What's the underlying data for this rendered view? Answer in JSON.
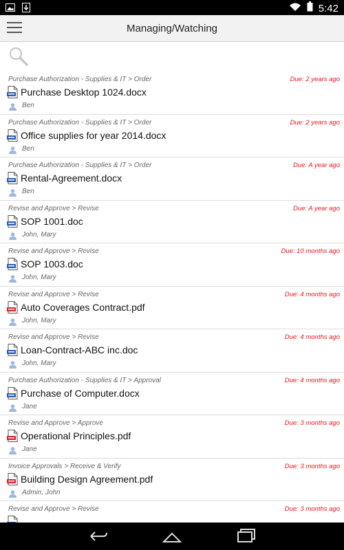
{
  "status_bar": {
    "time": "5:42",
    "icons": [
      "gallery-icon",
      "download-icon",
      "wifi-icon",
      "battery-icon"
    ]
  },
  "app_bar": {
    "title": "Managing/Watching",
    "menu_icon": "hamburger-menu-icon"
  },
  "search": {
    "icon": "search-icon"
  },
  "items": [
    {
      "path": "Purchase Authorization - Supplies & IT > Order",
      "name": "Purchase Desktop 1024.docx",
      "type": "doc",
      "people": "Ben",
      "due": "Due: 2 years ago"
    },
    {
      "path": "Purchase Authorization - Supplies & IT > Order",
      "name": "Office supplies for year 2014.docx",
      "type": "doc",
      "people": "Ben",
      "due": "Due: 2 years ago"
    },
    {
      "path": "Purchase Authorization - Supplies & IT > Order",
      "name": "Rental-Agreement.docx",
      "type": "doc",
      "people": "Ben",
      "due": "Due: A year ago"
    },
    {
      "path": "Revise and Approve > Revise",
      "name": "SOP 1001.doc",
      "type": "doc",
      "people": "John, Mary",
      "due": "Due: A year ago"
    },
    {
      "path": "Revise and Approve > Revise",
      "name": "SOP 1003.doc",
      "type": "doc",
      "people": "John, Mary",
      "due": "Due: 10 months ago"
    },
    {
      "path": "Revise and Approve > Revise",
      "name": "Auto Coverages Contract.pdf",
      "type": "pdf",
      "people": "John, Mary",
      "due": "Due: 4 months ago"
    },
    {
      "path": "Revise and Approve > Revise",
      "name": "Loan-Contract-ABC inc.doc",
      "type": "doc",
      "people": "John, Mary",
      "due": "Due: 4 months ago"
    },
    {
      "path": "Purchase Authorization - Supplies & IT > Approval",
      "name": "Purchase of Computer.docx",
      "type": "doc",
      "people": "Jane",
      "due": "Due: 4 months ago"
    },
    {
      "path": "Revise and Approve > Approve",
      "name": "Operational Principles.pdf",
      "type": "pdf",
      "people": "Jane",
      "due": "Due: 3 months ago"
    },
    {
      "path": "Invoice Approvals > Receive & Verify",
      "name": "Building Design Agreement.pdf",
      "type": "pdf",
      "people": "Admin, John",
      "due": "Due: 3 months ago"
    },
    {
      "path": "Revise and Approve > Revise",
      "name": "",
      "type": "doc",
      "people": "",
      "due": "Due: 3 months ago"
    }
  ],
  "colors": {
    "due_text": "#e8151b",
    "doc_icon": "#2a5db0",
    "pdf_icon": "#d9262c",
    "person_icon": "#9bb9dc"
  },
  "nav_bar": {
    "icons": [
      "back-icon",
      "home-icon",
      "recent-apps-icon"
    ]
  }
}
